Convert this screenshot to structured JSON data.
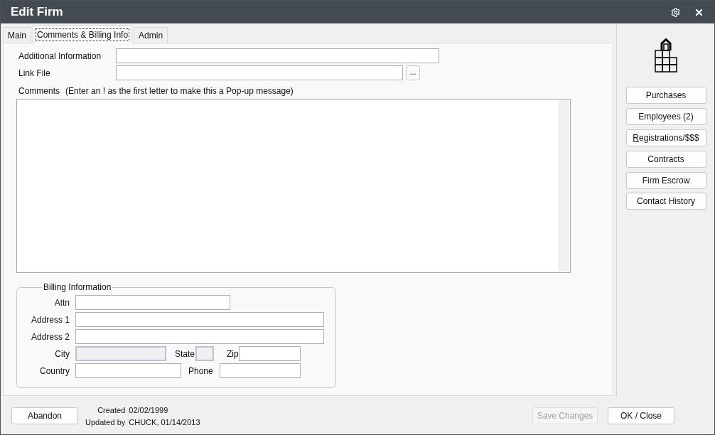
{
  "window": {
    "title": "Edit Firm"
  },
  "tabs": [
    {
      "label": "Main",
      "selected": false
    },
    {
      "label": "Comments & Billing Info",
      "selected": true
    },
    {
      "label": "Admin",
      "selected": false
    }
  ],
  "fields": [
    {
      "label": "Additional Information",
      "kind": "text"
    },
    {
      "label": "Link File",
      "kind": "file",
      "button": "..."
    }
  ],
  "comments": {
    "label": "Comments",
    "hint": "(Enter an ! as the first letter to make this a Pop-up message)"
  },
  "billing": {
    "title": "Billing Information",
    "rows": [
      {
        "fields": [
          {
            "label": "Attn",
            "disabled": false
          }
        ]
      },
      {
        "fields": [
          {
            "label": "Address 1",
            "disabled": false
          }
        ]
      },
      {
        "fields": [
          {
            "label": "Address 2",
            "disabled": false
          }
        ]
      },
      {
        "fields": [
          {
            "label": "City",
            "disabled": true
          },
          {
            "label": "State",
            "disabled": true
          },
          {
            "label": "Zip",
            "disabled": false
          }
        ]
      },
      {
        "fields": [
          {
            "label": "Country",
            "disabled": false
          },
          {
            "label": "Phone",
            "disabled": false
          }
        ]
      }
    ]
  },
  "side_buttons": [
    {
      "label": "Purchases",
      "mnemonic": false
    },
    {
      "label": "Employees (2)",
      "mnemonic": false
    },
    {
      "label": "Registrations/$$$",
      "mnemonic": true
    },
    {
      "label": "Contracts",
      "mnemonic": false
    },
    {
      "label": "Firm Escrow",
      "mnemonic": false
    },
    {
      "label": "Contact History",
      "mnemonic": false
    }
  ],
  "footer": {
    "abandon": "Abandon",
    "created_label": "Created",
    "created_value": "02/02/1999",
    "updated_label": "Updated by",
    "updated_value": "CHUCK, 01/14/2013",
    "buttons": [
      {
        "label": "Save Changes",
        "disabled": true
      },
      {
        "label": "OK / Close",
        "disabled": false
      }
    ]
  }
}
